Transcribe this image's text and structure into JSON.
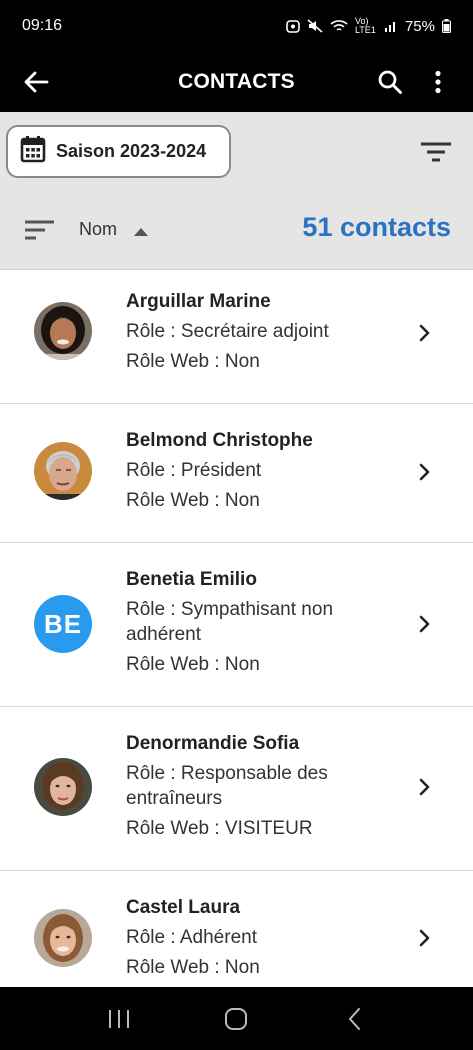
{
  "status_bar": {
    "time": "09:16",
    "battery": "75%",
    "network_label": "Vo) LTE1"
  },
  "app_bar": {
    "title": "CONTACTS",
    "icons": [
      "back-arrow-icon",
      "search-icon",
      "more-vert-icon"
    ]
  },
  "filters": {
    "season_label": "Saison 2023-2024",
    "sort_label": "Nom",
    "sort_direction": "ascending",
    "count_label": "51 contacts"
  },
  "contacts": [
    {
      "name": "Arguillar Marine",
      "role": "Rôle : Secrétaire adjoint",
      "web_role": "Rôle Web : Non",
      "avatar": "photo"
    },
    {
      "name": "Belmond Christophe",
      "role": "Rôle : Président",
      "web_role": "Rôle Web : Non",
      "avatar": "photo"
    },
    {
      "name": "Benetia Emilio",
      "role": "Rôle : Sympathisant non adhérent",
      "web_role": "Rôle Web : Non",
      "avatar": "initials",
      "initials": "BE"
    },
    {
      "name": "Denormandie Sofia",
      "role": "Rôle : Responsable des entraîneurs",
      "web_role": "Rôle Web : VISITEUR",
      "avatar": "photo"
    },
    {
      "name": "Castel Laura",
      "role": "Rôle : Adhérent",
      "web_role": "Rôle Web : Non",
      "avatar": "photo"
    }
  ],
  "colors": {
    "accent": "#2b72c2",
    "initials_avatar": "#2a9af0",
    "header": "#000000",
    "filter_background": "#e5e5e5"
  }
}
